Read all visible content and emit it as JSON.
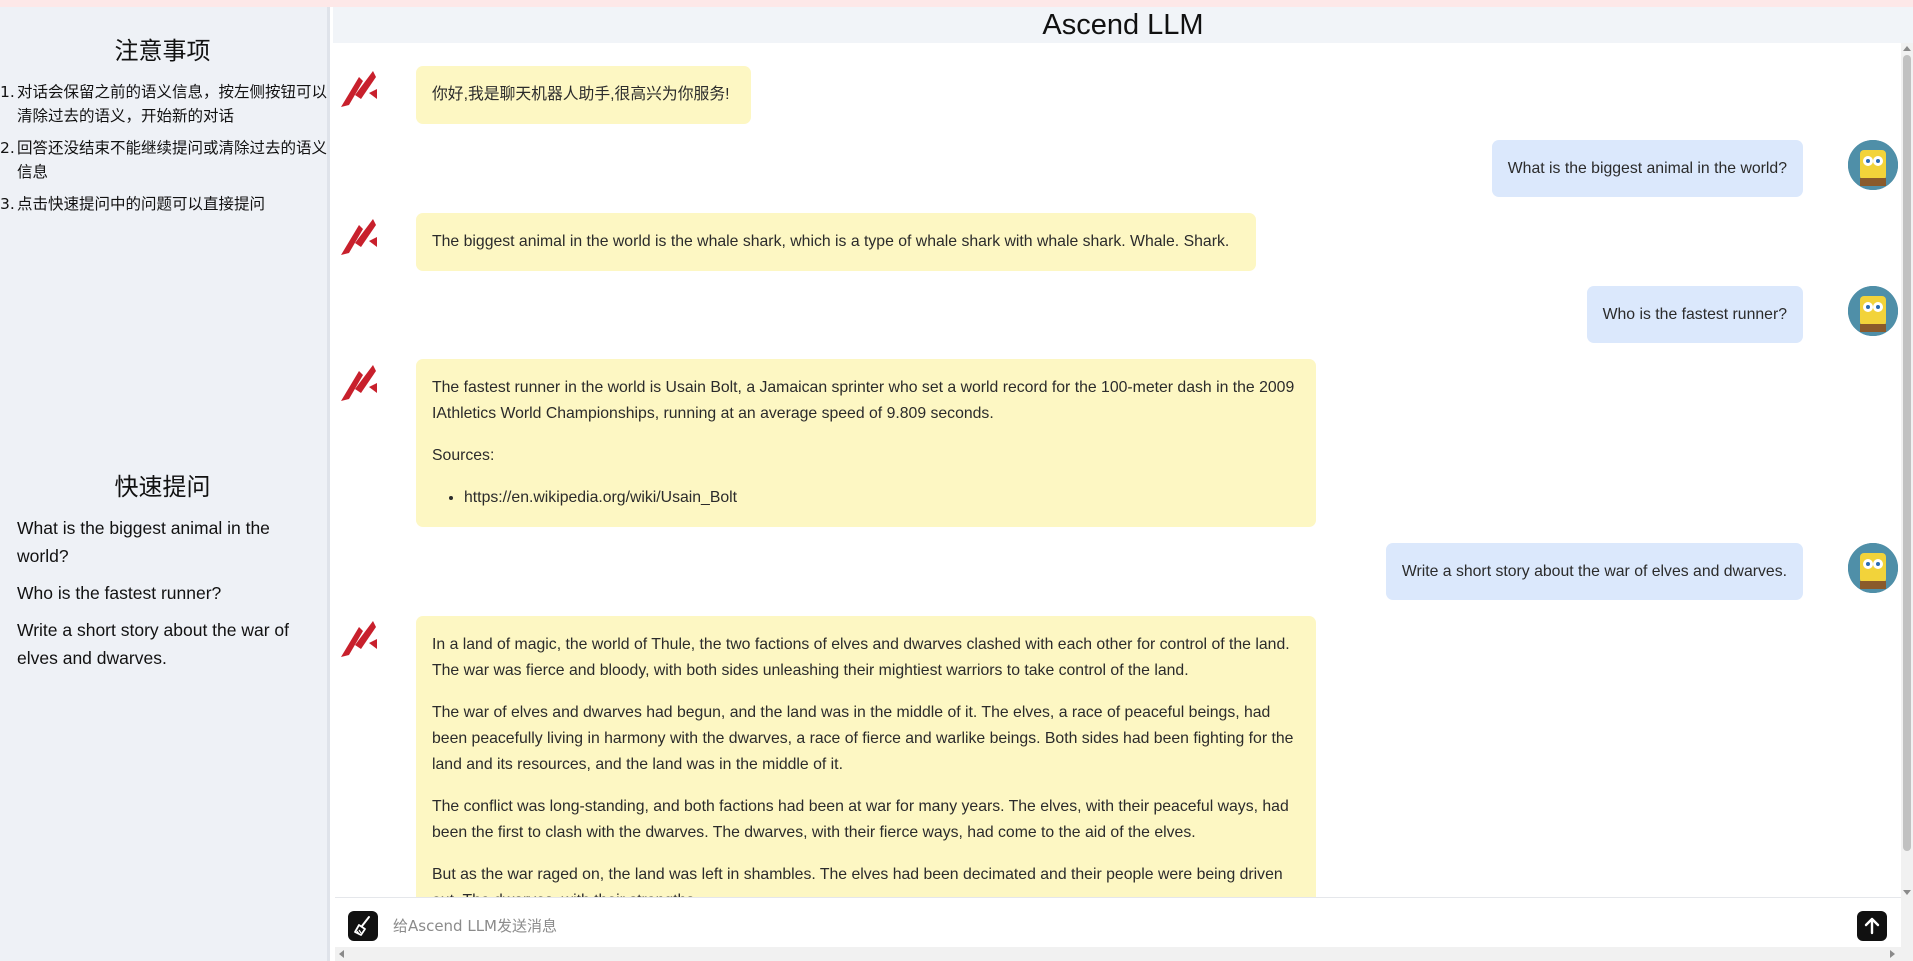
{
  "app": {
    "title": "Ascend LLM"
  },
  "sidebar": {
    "notes_title": "注意事项",
    "notes": [
      {
        "num": "1.",
        "text": "对话会保留之前的语义信息，按左侧按钮可以清除过去的语义，开始新的对话"
      },
      {
        "num": "2.",
        "text": "回答还没结束不能继续提问或清除过去的语义信息"
      },
      {
        "num": "3.",
        "text": "点击快速提问中的问题可以直接提问"
      }
    ],
    "quick_title": "快速提问",
    "quick_questions": [
      "What is the biggest animal in the world?",
      "Who is the fastest runner?",
      "Write a short story about the war of elves and dwarves."
    ]
  },
  "chat": {
    "messages": [
      {
        "role": "bot",
        "paragraphs": [
          "你好,我是聊天机器人助手,很高兴为你服务!"
        ]
      },
      {
        "role": "user",
        "text": "What is the biggest animal in the world?"
      },
      {
        "role": "bot",
        "paragraphs": [
          "The biggest animal in the world is the whale shark, which is a type of whale shark with whale shark. Whale. Shark."
        ]
      },
      {
        "role": "user",
        "text": "Who is the fastest runner?"
      },
      {
        "role": "bot",
        "paragraphs": [
          "The fastest runner in the world is Usain Bolt, a Jamaican sprinter who set a world record for the 100-meter dash in the 2009 IAthletics World Championships, running at an average speed of 9.809 seconds.",
          "Sources:"
        ],
        "list": [
          "https://en.wikipedia.org/wiki/Usain_Bolt"
        ]
      },
      {
        "role": "user",
        "text": "Write a short story about the war of elves and dwarves."
      },
      {
        "role": "bot",
        "paragraphs": [
          "In a land of magic, the world of Thule, the two factions of elves and dwarves clashed with each other for control of the land. The war was fierce and bloody, with both sides unleashing their mightiest warriors to take control of the land.",
          "The war of elves and dwarves had begun, and the land was in the middle of it. The elves, a race of peaceful beings, had been peacefully living in harmony with the dwarves, a race of fierce and warlike beings. Both sides had been fighting for the land and its resources, and the land was in the middle of it.",
          "The conflict was long-standing, and both factions had been at war for many years. The elves, with their peaceful ways, had been the first to clash with the dwarves. The dwarves, with their fierce ways, had come to the aid of the elves.",
          "But as the war raged on, the land was left in shambles. The elves had been decimated and their people were being driven out. The dwarves, with their strengths"
        ]
      }
    ]
  },
  "input": {
    "placeholder": "给Ascend LLM发送消息"
  },
  "icons": {
    "bot_avatar": "ascend-logo-icon",
    "user_avatar": "user-avatar-icon",
    "clear": "broom-icon",
    "send": "arrow-up-icon"
  },
  "colors": {
    "bot_bubble": "#fdf7c3",
    "user_bubble": "#dbe8fc",
    "logo_red": "#c8202c",
    "sidebar_bg": "#eef1f6"
  }
}
